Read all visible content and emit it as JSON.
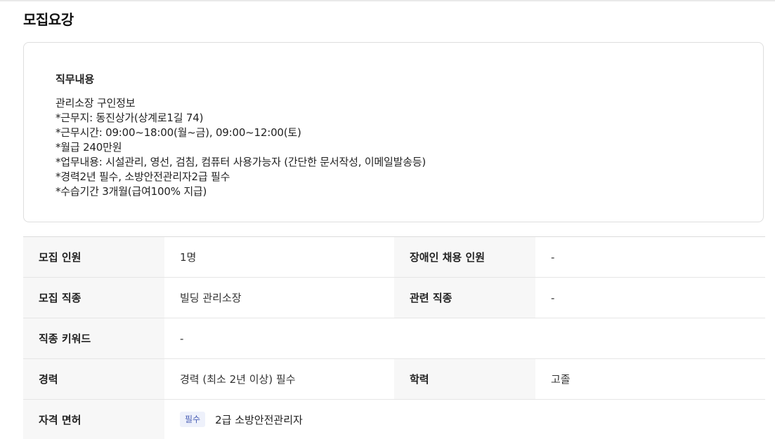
{
  "section_title": "모집요강",
  "job_description": {
    "heading": "직무내용",
    "lines": [
      "관리소장 구인정보",
      "*근무지: 동진상가(상계로1길 74)",
      "*근무시간: 09:00~18:00(월~금), 09:00~12:00(토)",
      "*월급 240만원",
      "*업무내용: 시설관리, 영선, 검침, 컴퓨터 사용가능자 (간단한 문서작성, 이메일발송등)",
      "*경력2년 필수, 소방안전관리자2급 필수",
      "*수습기간 3개월(급여100% 지급)"
    ]
  },
  "info": {
    "recruit_count": {
      "label": "모집 인원",
      "value": "1명"
    },
    "disabled_count": {
      "label": "장애인 채용 인원",
      "value": "-"
    },
    "job_type": {
      "label": "모집 직종",
      "value": "빌딩 관리소장"
    },
    "related_job": {
      "label": "관련 직종",
      "value": "-"
    },
    "job_keyword": {
      "label": "직종 키워드",
      "value": "-"
    },
    "career": {
      "label": "경력",
      "value": "경력 (최소 2년 이상) 필수"
    },
    "education": {
      "label": "학력",
      "value": "고졸"
    },
    "license": {
      "label": "자격 면허",
      "badge": "필수",
      "value": "2급 소방안전관리자"
    }
  },
  "colors": {
    "label_bg": "#f7f7f7",
    "border": "#dedede",
    "badge_bg": "#eef1fb",
    "badge_text": "#4a5fb5"
  }
}
